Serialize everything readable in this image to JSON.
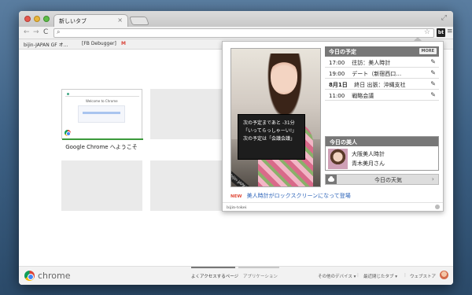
{
  "browser": {
    "tab_title": "新しいタブ",
    "tab_close": "×",
    "fullscreen_glyph": "⤢",
    "nav_back": "←",
    "nav_forward": "→",
    "reload": "C",
    "omnibox_value": "",
    "omnibox_placeholder": "",
    "extension_label": "bt",
    "menu_glyph": "≡",
    "bookmarks": [
      {
        "label": "bijin-JAPAN GF オ…",
        "icon": "bookmark-favicon"
      },
      {
        "label": "[FB Debugger]",
        "icon": "page-icon"
      },
      {
        "label": "M",
        "icon": "gmail-icon"
      }
    ]
  },
  "new_tab_page": {
    "tiles": [
      {
        "label": "Google Chrome へようこそ",
        "thumb_title": "Welcome to Chrome"
      },
      {
        "label": ""
      },
      {
        "label": ""
      },
      {
        "label": ""
      },
      {
        "label": ""
      },
      {
        "label": ""
      }
    ],
    "footer": {
      "brand": "chrome",
      "tabs": [
        {
          "label": "よくアクセスするページ",
          "active": true
        },
        {
          "label": "アプリケーション",
          "active": false
        }
      ],
      "links": [
        "その他のデバイス ▾",
        "最近閉じたタブ ▾",
        "ウェブストア"
      ]
    }
  },
  "popup": {
    "photo_board_lines": [
      "次の予定まであと -31分",
      "「いってらっしゃーい!」",
      "次の予定は「会議会議」"
    ],
    "photo_sash": "bijin-JAPAN",
    "schedule_title": "今日の予定",
    "more_label": "MORE",
    "schedule": [
      {
        "time": "17:00",
        "bold": false,
        "text": "往訪：美人時計"
      },
      {
        "time": "19:00",
        "bold": false,
        "text": "デート（新宿西口…"
      },
      {
        "time": "8月1日",
        "bold": true,
        "text": "終日  出張：沖縄支社"
      },
      {
        "time": "11:00",
        "bold": false,
        "text": "戦略会議"
      }
    ],
    "pencil_glyph": "✎",
    "bijin_title": "今日の美人",
    "bijin_line1": "大阪美人時計",
    "bijin_line2": "青木美月さん",
    "weather_label": "今日の天気",
    "weather_arrow": "›",
    "news_badge": "NEW",
    "news_headline": "美人時計がロックスクリーンになって登場",
    "footer_brand": "bijin-tokei"
  },
  "colors": {
    "accent_red": "#e04b3a",
    "link_blue": "#2a62b8",
    "header_gray": "#777777",
    "welcome_green": "#3a9a3a"
  }
}
